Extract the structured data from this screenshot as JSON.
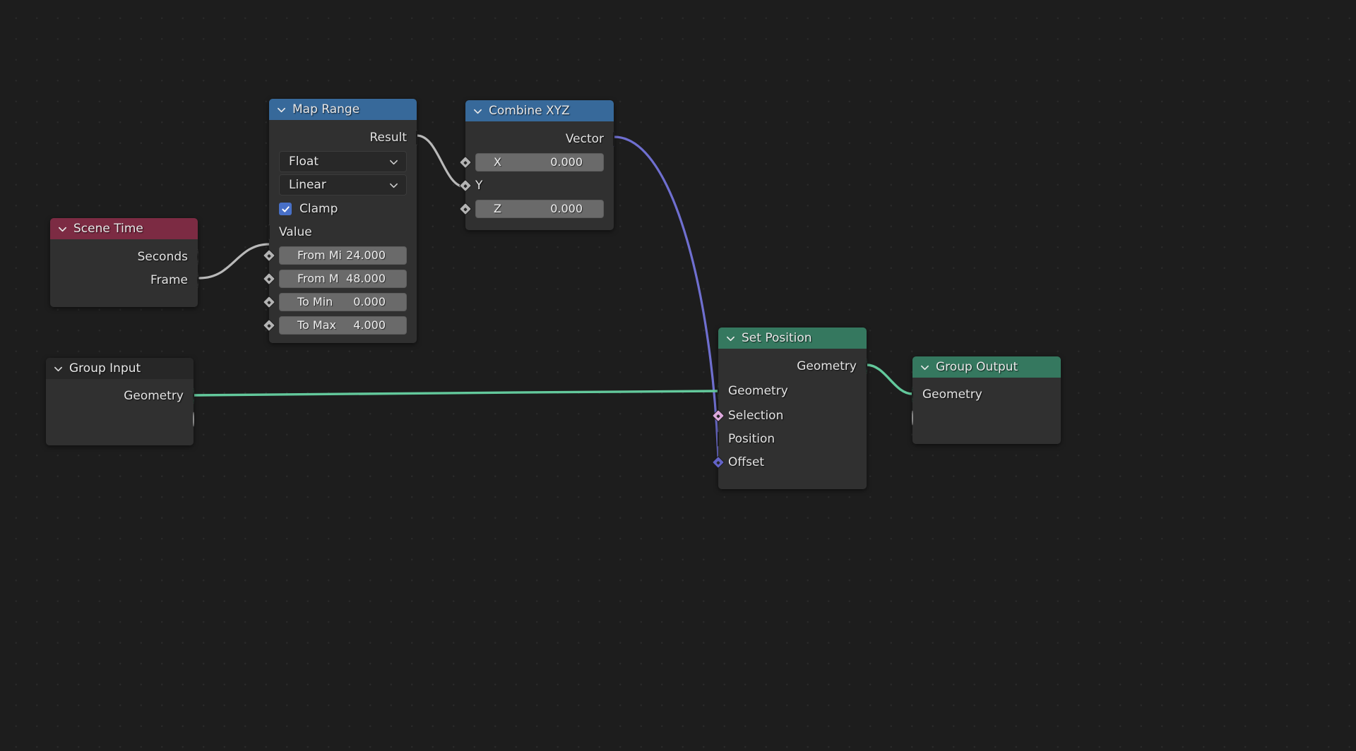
{
  "editor": {
    "name": "Blender Geometry Node Editor",
    "background": "#1d1d1d",
    "grid_dot_color": "#2a2a2a"
  },
  "colors": {
    "header_blue": "#37699a",
    "header_maroon": "#7c2b43",
    "header_green": "#35785f",
    "header_dark": "#272727",
    "node_body": "#303030",
    "socket_geometry": "#63c99c",
    "socket_float": "#b3b3b3",
    "socket_vector": "#6363c7",
    "socket_boolean": "#dda8dd",
    "socket_gray": "#a1a1a1",
    "checkbox_blue": "#4870c8",
    "wire_geometry": "#63c99c",
    "wire_float": "#b9b9b9",
    "wire_vector": "#6f6fd0"
  },
  "nodes": {
    "scene_time": {
      "title": "Scene Time",
      "header_color": "#7c2b43",
      "outputs": [
        {
          "label": "Seconds",
          "socket": "float-circle"
        },
        {
          "label": "Frame",
          "socket": "float-circle"
        }
      ]
    },
    "map_range": {
      "title": "Map Range",
      "header_color": "#37699a",
      "outputs": [
        {
          "label": "Result",
          "socket": "float-diamond"
        }
      ],
      "data_type": {
        "label": "Float",
        "icon": "chevron-down-icon"
      },
      "interpolation": {
        "label": "Linear",
        "icon": "chevron-down-icon"
      },
      "clamp": {
        "label": "Clamp",
        "checked": true
      },
      "inputs": [
        {
          "label": "Value",
          "socket": "float-diamond",
          "widget": false
        },
        {
          "label": "From Mi",
          "value": "24.000",
          "socket": "float-diamond-dot",
          "widget": true
        },
        {
          "label": "From M",
          "value": "48.000",
          "socket": "float-diamond-dot",
          "widget": true
        },
        {
          "label": "To Min",
          "value": "0.000",
          "socket": "float-diamond-dot",
          "widget": true
        },
        {
          "label": "To Max",
          "value": "4.000",
          "socket": "float-diamond-dot",
          "widget": true
        }
      ]
    },
    "combine_xyz": {
      "title": "Combine XYZ",
      "header_color": "#37699a",
      "outputs": [
        {
          "label": "Vector",
          "socket": "vector-diamond"
        }
      ],
      "inputs": [
        {
          "label": "X",
          "value": "0.000",
          "socket": "float-diamond-dot",
          "widget": true
        },
        {
          "label": "Y",
          "value": "",
          "socket": "float-diamond-dot",
          "widget": false
        },
        {
          "label": "Z",
          "value": "0.000",
          "socket": "float-diamond-dot",
          "widget": true
        }
      ]
    },
    "group_input": {
      "title": "Group Input",
      "header_color": "#272727",
      "outputs": [
        {
          "label": "Geometry",
          "socket": "geometry-circle"
        },
        {
          "label": "",
          "socket": "empty-circle"
        }
      ]
    },
    "set_position": {
      "title": "Set Position",
      "header_color": "#35785f",
      "outputs": [
        {
          "label": "Geometry",
          "socket": "geometry-circle"
        }
      ],
      "inputs": [
        {
          "label": "Geometry",
          "socket": "geometry-circle"
        },
        {
          "label": "Selection",
          "socket": "boolean-diamond-dot"
        },
        {
          "label": "Position",
          "socket": "vector-diamond"
        },
        {
          "label": "Offset",
          "socket": "vector-diamond-dot"
        }
      ]
    },
    "group_output": {
      "title": "Group Output",
      "header_color": "#35785f",
      "inputs": [
        {
          "label": "Geometry",
          "socket": "geometry-circle"
        },
        {
          "label": "",
          "socket": "empty-circle"
        }
      ]
    }
  },
  "links": [
    {
      "from": "scene_time.Frame",
      "to": "map_range.Value",
      "color": "#b9b9b9"
    },
    {
      "from": "map_range.Result",
      "to": "combine_xyz.Y",
      "color": "#b9b9b9"
    },
    {
      "from": "combine_xyz.Vector",
      "to": "set_position.Offset",
      "color": "#6f6fd0"
    },
    {
      "from": "group_input.Geometry",
      "to": "set_position.Geometry",
      "color": "#63c99c"
    },
    {
      "from": "set_position.Geometry",
      "to": "group_output.Geometry",
      "color": "#63c99c"
    }
  ]
}
